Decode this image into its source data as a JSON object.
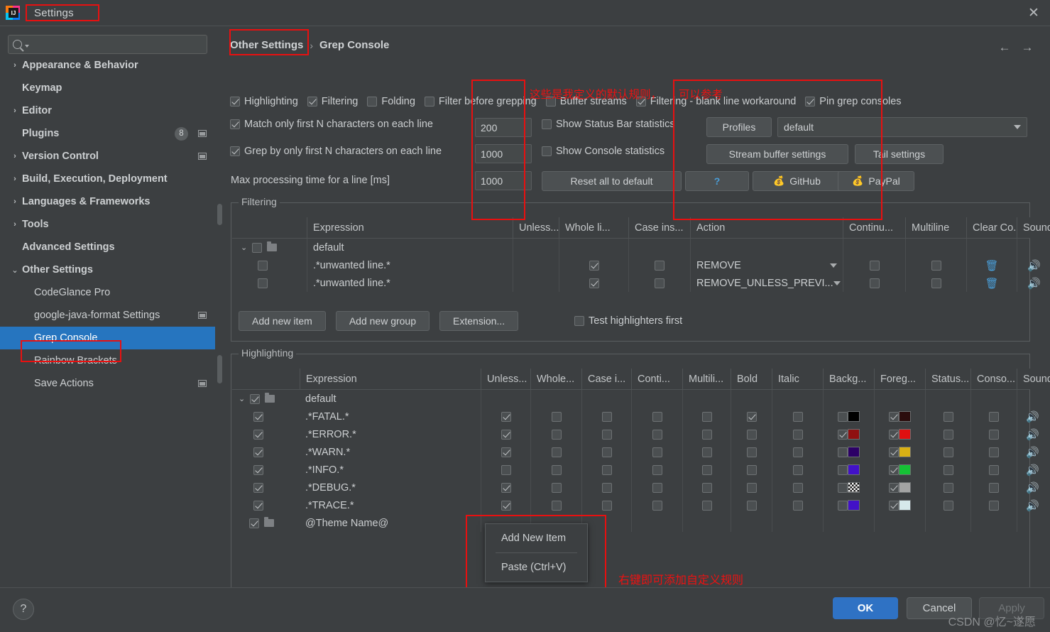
{
  "window": {
    "title": "Settings",
    "close_icon": "close-icon",
    "app_icon": "intellij-idea-icon"
  },
  "search": {
    "value": "",
    "placeholder": "",
    "icon": "search-icon"
  },
  "sidebar": {
    "items": [
      {
        "label": "Appearance & Behavior",
        "arrow": "›",
        "bold": true,
        "indent": 0
      },
      {
        "label": "Keymap",
        "arrow": "",
        "bold": true,
        "indent": 0
      },
      {
        "label": "Editor",
        "arrow": "›",
        "bold": true,
        "indent": 0
      },
      {
        "label": "Plugins",
        "arrow": "",
        "bold": true,
        "indent": 0,
        "badge": "8",
        "mini": true
      },
      {
        "label": "Version Control",
        "arrow": "›",
        "bold": true,
        "indent": 0,
        "mini": true
      },
      {
        "label": "Build, Execution, Deployment",
        "arrow": "›",
        "bold": true,
        "indent": 0
      },
      {
        "label": "Languages & Frameworks",
        "arrow": "›",
        "bold": true,
        "indent": 0
      },
      {
        "label": "Tools",
        "arrow": "›",
        "bold": true,
        "indent": 0
      },
      {
        "label": "Advanced Settings",
        "arrow": "",
        "bold": true,
        "indent": 0
      },
      {
        "label": "Other Settings",
        "arrow": "⌄",
        "bold": true,
        "indent": 0,
        "expanded": true
      },
      {
        "label": "CodeGlance Pro",
        "arrow": "",
        "bold": false,
        "indent": 1
      },
      {
        "label": "google-java-format Settings",
        "arrow": "",
        "bold": false,
        "indent": 1,
        "mini": true
      },
      {
        "label": "Grep Console",
        "arrow": "",
        "bold": false,
        "indent": 1,
        "selected": true
      },
      {
        "label": "Rainbow Brackets",
        "arrow": "",
        "bold": false,
        "indent": 1
      },
      {
        "label": "Save Actions",
        "arrow": "",
        "bold": false,
        "indent": 1,
        "mini": true
      }
    ]
  },
  "breadcrumb": {
    "parent": "Other Settings",
    "sep": "›",
    "current": "Grep Console"
  },
  "nav": {
    "back": "←",
    "forward": "→"
  },
  "options": {
    "row1": [
      {
        "label": "Highlighting",
        "checked": true
      },
      {
        "label": "Filtering",
        "checked": true
      },
      {
        "label": "Folding",
        "checked": false
      },
      {
        "label": "Filter before grepping",
        "checked": false
      },
      {
        "label": "Buffer streams",
        "checked": false
      },
      {
        "label": "Filtering - blank line workaround",
        "checked": true
      },
      {
        "label": "Pin grep consoles",
        "checked": true
      }
    ],
    "match_first_n": {
      "label": "Match only first N characters on each line",
      "checked": true,
      "value": "200"
    },
    "show_status_bar": {
      "label": "Show Status Bar statistics",
      "checked": false
    },
    "profiles_button": "Profiles",
    "profile_selected": "default",
    "grep_first_n": {
      "label": "Grep by only first N characters on each line",
      "checked": true,
      "value": "1000"
    },
    "show_console_stats": {
      "label": "Show Console statistics",
      "checked": false
    },
    "stream_buffer_button": "Stream buffer settings",
    "tail_settings_button": "Tail settings",
    "max_processing_label": "Max processing time for a line [ms]",
    "max_processing_value": "1000",
    "reset_button": "Reset all to default",
    "help_button": "?",
    "github_button": "GitHub",
    "paypal_button": "PayPal"
  },
  "filtering": {
    "title": "Filtering",
    "columns": [
      "Expression",
      "Unless...",
      "Whole li...",
      "Case ins...",
      "Action",
      "Continu...",
      "Multiline",
      "Clear Co...",
      "Sound"
    ],
    "rows": [
      {
        "type": "group",
        "expression": "default",
        "enabled": false,
        "whole": null,
        "case": null,
        "action": "",
        "continue": null,
        "multiline": null,
        "clear": false,
        "sound": false
      },
      {
        "type": "item",
        "expression": ".*unwanted line.*",
        "enabled": false,
        "whole": true,
        "case": false,
        "action": "REMOVE",
        "continue": false,
        "multiline": false,
        "clear": true,
        "sound": true
      },
      {
        "type": "item",
        "expression": ".*unwanted line.*",
        "enabled": false,
        "whole": true,
        "case": false,
        "action": "REMOVE_UNLESS_PREVI...",
        "continue": false,
        "multiline": false,
        "clear": true,
        "sound": true
      }
    ],
    "buttons": [
      "Add new item",
      "Add new group",
      "Extension..."
    ],
    "test_highlighters": {
      "label": "Test highlighters first",
      "checked": false
    }
  },
  "highlighting": {
    "title": "Highlighting",
    "columns": [
      "Expression",
      "Unless...",
      "Whole...",
      "Case i...",
      "Conti...",
      "Multili...",
      "Bold",
      "Italic",
      "Backg...",
      "Foreg...",
      "Status...",
      "Conso...",
      "Sound"
    ],
    "rows": [
      {
        "type": "group",
        "expression": "default",
        "enabled": true
      },
      {
        "type": "item",
        "expression": ".*FATAL.*",
        "enabled": true,
        "unless": true,
        "whole": false,
        "case": false,
        "continue": false,
        "multiline": false,
        "bold": true,
        "italic": false,
        "bg_on": false,
        "bg_color": "#000000",
        "fg_on": true,
        "fg_color": "#2b0d0d",
        "status": false,
        "console": false,
        "sound": true
      },
      {
        "type": "item",
        "expression": ".*ERROR.*",
        "enabled": true,
        "unless": true,
        "whole": false,
        "case": false,
        "continue": false,
        "multiline": false,
        "bold": false,
        "italic": false,
        "bg_on": true,
        "bg_color": "#8f1010",
        "fg_on": true,
        "fg_color": "#e01010",
        "status": false,
        "console": false,
        "sound": true
      },
      {
        "type": "item",
        "expression": ".*WARN.*",
        "enabled": true,
        "unless": true,
        "whole": false,
        "case": false,
        "continue": false,
        "multiline": false,
        "bold": false,
        "italic": false,
        "bg_on": false,
        "bg_color": "#2c0066",
        "fg_on": true,
        "fg_color": "#d9b014",
        "status": false,
        "console": false,
        "sound": true
      },
      {
        "type": "item",
        "expression": ".*INFO.*",
        "enabled": true,
        "unless": false,
        "whole": false,
        "case": false,
        "continue": false,
        "multiline": false,
        "bold": false,
        "italic": false,
        "bg_on": false,
        "bg_color": "#4211c8",
        "fg_on": true,
        "fg_color": "#15c135",
        "status": false,
        "console": false,
        "sound": true
      },
      {
        "type": "item",
        "expression": ".*DEBUG.*",
        "enabled": true,
        "unless": true,
        "whole": false,
        "case": false,
        "continue": false,
        "multiline": false,
        "bold": false,
        "italic": false,
        "bg_on": false,
        "bg_color": "checker",
        "fg_on": true,
        "fg_color": "#a3a3a3",
        "status": false,
        "console": false,
        "sound": true
      },
      {
        "type": "item",
        "expression": ".*TRACE.*",
        "enabled": true,
        "unless": true,
        "whole": false,
        "case": false,
        "continue": false,
        "multiline": false,
        "bold": false,
        "italic": false,
        "bg_on": false,
        "bg_color": "#4211c8",
        "fg_on": true,
        "fg_color": "#d6e8eb",
        "status": false,
        "console": false,
        "sound": true
      },
      {
        "type": "group",
        "expression": "@Theme Name@",
        "enabled": true
      }
    ]
  },
  "context_menu": {
    "items": [
      "Add New Item",
      "Paste (Ctrl+V)"
    ]
  },
  "annotations": {
    "note_default_rules": "这些是我定义的默认规则，",
    "note_reference": "可以参考",
    "note_right_click": "右键即可添加自定义规则"
  },
  "footer": {
    "help": "?",
    "ok": "OK",
    "cancel": "Cancel",
    "apply": "Apply",
    "watermark": "CSDN @忆~遂愿"
  },
  "colors": {
    "accent": "#2675bf",
    "annotation_red": "#e81010",
    "background": "#3c3f41"
  }
}
